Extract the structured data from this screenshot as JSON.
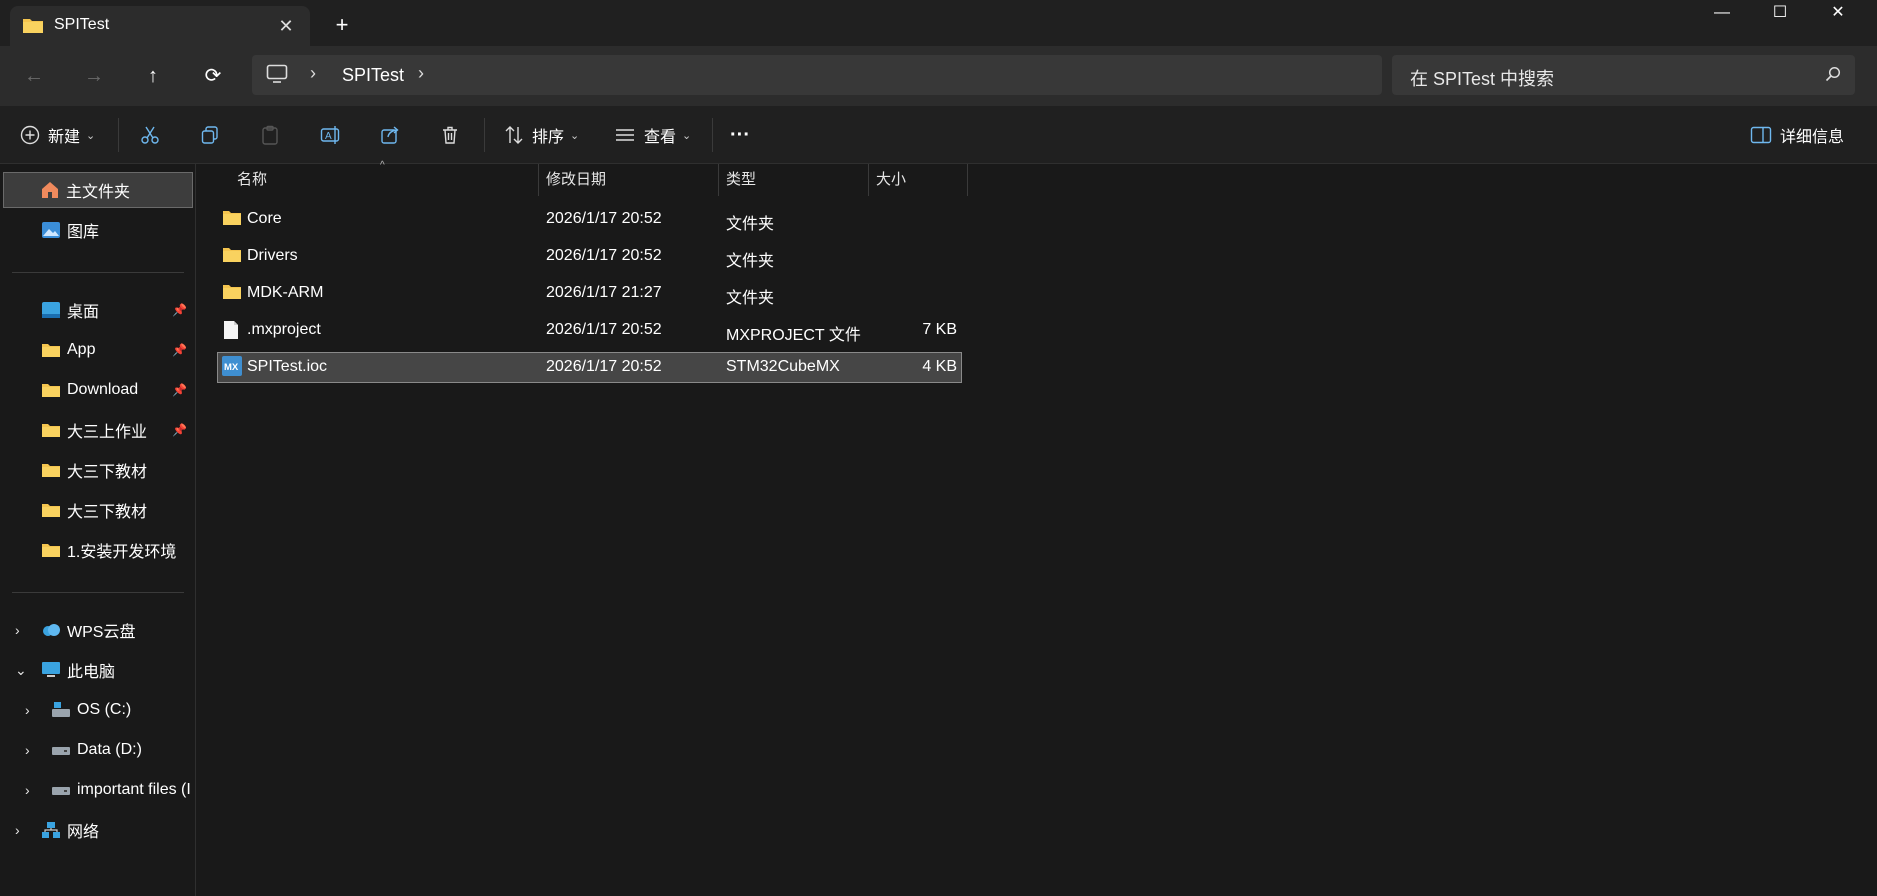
{
  "window": {
    "tab_title": "SPITest",
    "tab_close": "✕",
    "new_tab": "+",
    "minimize": "—",
    "maximize": "☐",
    "close": "✕"
  },
  "nav": {
    "back": "←",
    "forward": "→",
    "up": "↑",
    "refresh": "⟳",
    "breadcrumb": "SPITest",
    "search_placeholder": "在 SPITest 中搜索"
  },
  "toolbar": {
    "new_label": "新建",
    "sort_label": "排序",
    "view_label": "查看",
    "more_label": "···",
    "details_label": "详细信息"
  },
  "sidebar": {
    "home": "主文件夹",
    "gallery": "图库",
    "pinned": [
      {
        "label": "桌面",
        "icon": "desktop-icon"
      },
      {
        "label": "App",
        "icon": "folder-icon"
      },
      {
        "label": "Download",
        "icon": "folder-icon"
      },
      {
        "label": "大三上作业",
        "icon": "folder-icon"
      }
    ],
    "recent": [
      {
        "label": "大三下教材",
        "icon": "folder-icon"
      },
      {
        "label": "大三下教材",
        "icon": "folder-icon"
      },
      {
        "label": "1.安装开发环境",
        "icon": "folder-icon"
      }
    ],
    "wps": "WPS云盘",
    "this_pc": "此电脑",
    "drives": [
      {
        "label": "OS (C:)",
        "icon": "os-drive-icon"
      },
      {
        "label": "Data (D:)",
        "icon": "drive-icon"
      },
      {
        "label": "important files (I",
        "icon": "drive-icon"
      }
    ],
    "network": "网络"
  },
  "columns": {
    "name": "名称",
    "modified": "修改日期",
    "type": "类型",
    "size": "大小"
  },
  "files": [
    {
      "name": "Core",
      "modified": "2026/1/17 20:52",
      "type": "文件夹",
      "size": "",
      "icon": "folder-icon"
    },
    {
      "name": "Drivers",
      "modified": "2026/1/17 20:52",
      "type": "文件夹",
      "size": "",
      "icon": "folder-icon"
    },
    {
      "name": "MDK-ARM",
      "modified": "2026/1/17 21:27",
      "type": "文件夹",
      "size": "",
      "icon": "folder-icon"
    },
    {
      "name": ".mxproject",
      "modified": "2026/1/17 20:52",
      "type": "MXPROJECT 文件",
      "size": "7 KB",
      "icon": "file-icon"
    },
    {
      "name": "SPITest.ioc",
      "modified": "2026/1/17 20:52",
      "type": "STM32CubeMX",
      "size": "4 KB",
      "icon": "cubemx-icon",
      "selected": true
    }
  ],
  "colors": {
    "background": "#191919",
    "titlebar": "#202020",
    "folder": "#f4c44e",
    "accent": "#4aa3df"
  }
}
